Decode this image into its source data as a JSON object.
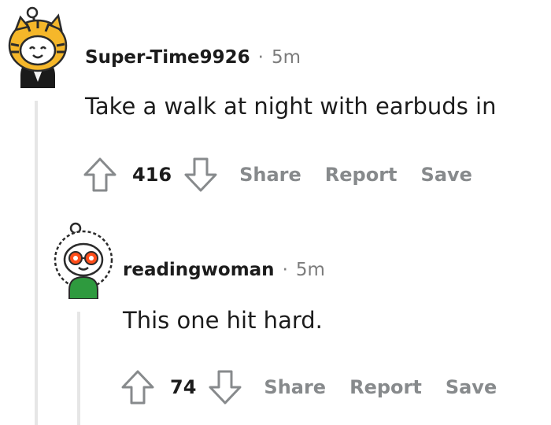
{
  "comments": [
    {
      "username": "Super-Time9926",
      "separator": "·",
      "time": "5m",
      "body": "Take a walk at night with earbuds in",
      "score": "416",
      "avatar": "snoo-avatar-tiger-hood",
      "actions": {
        "share": "Share",
        "report": "Report",
        "save": "Save"
      }
    },
    {
      "username": "readingwoman",
      "separator": "·",
      "time": "5m",
      "body": "This one hit hard.",
      "score": "74",
      "avatar": "snoo-avatar-red-glasses-green-shirt",
      "actions": {
        "share": "Share",
        "report": "Report",
        "save": "Save"
      }
    }
  ],
  "icons": {
    "upvote": "arrow-up-outline-icon",
    "downvote": "arrow-down-outline-icon"
  },
  "colors": {
    "muted": "#878a8c",
    "thread_line": "#e6e6e6",
    "text": "#1c1c1c"
  }
}
